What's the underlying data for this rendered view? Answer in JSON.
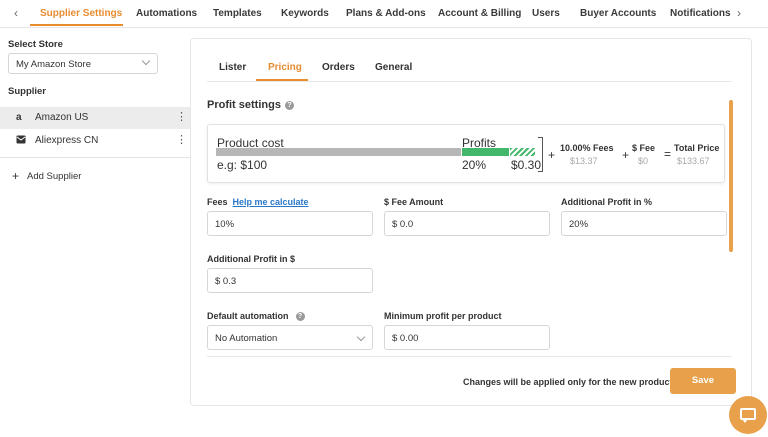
{
  "nav": {
    "prev_icon": "chevron-left-icon",
    "next_icon": "chevron-right-icon",
    "tabs": [
      "Supplier Settings",
      "Automations",
      "Templates",
      "Keywords",
      "Plans & Add-ons",
      "Account & Billing",
      "Users",
      "Buyer Accounts",
      "Notifications"
    ],
    "active_tab": "Supplier Settings"
  },
  "sidebar": {
    "store_label": "Select Store",
    "store_value": "My Amazon Store",
    "supplier_label": "Supplier",
    "suppliers": [
      {
        "name": "Amazon US",
        "icon": "amazon-icon",
        "selected": true
      },
      {
        "name": "Aliexpress CN",
        "icon": "mail-icon",
        "selected": false
      }
    ],
    "add_supplier": "Add Supplier"
  },
  "subtabs": [
    "Lister",
    "Pricing",
    "Orders",
    "General"
  ],
  "active_subtab": "Pricing",
  "profit": {
    "title": "Profit settings",
    "calc": {
      "product_cost_label": "Product cost",
      "product_cost_hint": "e.g: $100",
      "profits_label": "Profits",
      "profit_percent": "20%",
      "profit_dollar": "$0.30",
      "fees_label": "10.00% Fees",
      "fees_value": "$13.37",
      "fee_label": "$ Fee",
      "fee_value": "$0",
      "total_label": "Total Price",
      "total_value": "$133.67",
      "plus": "+",
      "equals": "="
    }
  },
  "form": {
    "fees_label": "Fees",
    "help_link": "Help me calculate",
    "fees_value": "10%",
    "fee_amount_label": "$ Fee Amount",
    "fee_amount_value": "$ 0.0",
    "add_profit_pct_label": "Additional Profit in %",
    "add_profit_pct_value": "20%",
    "add_profit_dollar_label": "Additional Profit in $",
    "add_profit_dollar_value": "$ 0.3",
    "default_automation_label": "Default automation",
    "default_automation_value": "No Automation",
    "min_profit_label": "Minimum profit per product",
    "min_profit_value": "$ 0.00"
  },
  "footer": {
    "note": "Changes will be applied only for the new products",
    "save_label": "Save"
  },
  "colors": {
    "accent": "#e88c30",
    "button": "#e8a04a",
    "profit_bar": "#44b86a",
    "link": "#2a77c9"
  }
}
